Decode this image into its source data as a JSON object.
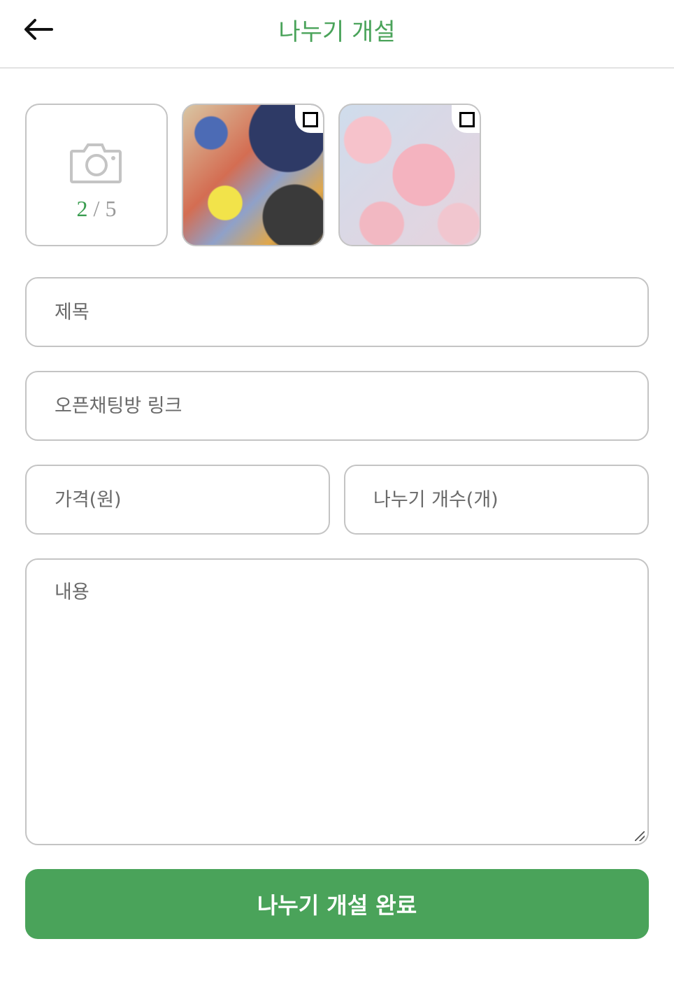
{
  "header": {
    "title": "나누기 개설",
    "back_icon": "arrow-left-icon"
  },
  "photos": {
    "current_count": "2",
    "separator": " / ",
    "max_count": "5",
    "camera_icon": "camera-icon",
    "items": [
      {
        "description_icon": "paint-palette-photo"
      },
      {
        "description_icon": "cherry-blossom-photo"
      }
    ]
  },
  "form": {
    "title_placeholder": "제목",
    "link_placeholder": "오픈채팅방 링크",
    "price_placeholder": "가격(원)",
    "quantity_placeholder": "나누기 개수(개)",
    "content_placeholder": "내용"
  },
  "submit_label": "나누기 개설 완료",
  "colors": {
    "accent": "#4aa35a",
    "border": "#c4c4c4"
  }
}
